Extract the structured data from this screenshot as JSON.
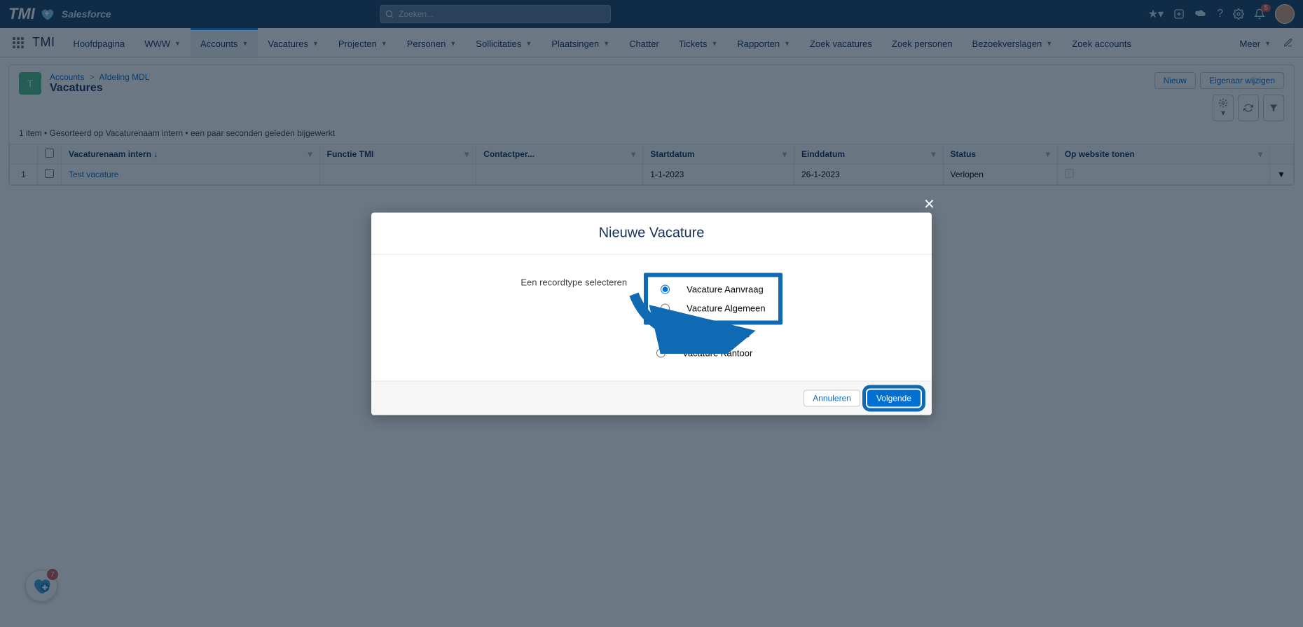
{
  "brand": {
    "main": "TMI",
    "sub": "Salesforce"
  },
  "search": {
    "placeholder": "Zoeken..."
  },
  "header_actions": {
    "notification_count": "5"
  },
  "app": {
    "name": "TMI"
  },
  "nav": [
    {
      "label": "Hoofdpagina",
      "dd": false
    },
    {
      "label": "WWW",
      "dd": true
    },
    {
      "label": "Accounts",
      "dd": true,
      "active": true
    },
    {
      "label": "Vacatures",
      "dd": true
    },
    {
      "label": "Projecten",
      "dd": true
    },
    {
      "label": "Personen",
      "dd": true
    },
    {
      "label": "Sollicitaties",
      "dd": true
    },
    {
      "label": "Plaatsingen",
      "dd": true
    },
    {
      "label": "Chatter",
      "dd": false
    },
    {
      "label": "Tickets",
      "dd": true
    },
    {
      "label": "Rapporten",
      "dd": true
    },
    {
      "label": "Zoek vacatures",
      "dd": false
    },
    {
      "label": "Zoek personen",
      "dd": false
    },
    {
      "label": "Bezoekverslagen",
      "dd": true
    },
    {
      "label": "Zoek accounts",
      "dd": false
    }
  ],
  "nav_more_label": "Meer",
  "breadcrumb": {
    "root": "Accounts",
    "leaf": "Afdeling MDL"
  },
  "page_title": "Vacatures",
  "page_actions": {
    "new": "Nieuw",
    "change_owner": "Eigenaar wijzigen"
  },
  "list_meta": "1 item • Gesorteerd op Vacaturenaam intern • een paar seconden geleden bijgewerkt",
  "columns": {
    "name": "Vacaturenaam intern",
    "function": "Functie TMI",
    "contact": "Contactper...",
    "start": "Startdatum",
    "end": "Einddatum",
    "status": "Status",
    "website": "Op website tonen"
  },
  "rows": [
    {
      "num": "1",
      "name": "Test vacature",
      "function": "",
      "contact": "",
      "start": "1-1-2023",
      "end": "26-1-2023",
      "status": "Verlopen",
      "website": false
    }
  ],
  "assist_badge": "7",
  "modal": {
    "title": "Nieuwe Vacature",
    "select_label": "Een recordtype selecteren",
    "options": [
      {
        "label": "Vacature Aanvraag",
        "checked": true,
        "hl": true
      },
      {
        "label": "Vacature Algemeen",
        "checked": false,
        "hl": true
      },
      {
        "label": "Vacature Cursus",
        "checked": false,
        "hl": false
      },
      {
        "label": "Vacature Kantoor",
        "checked": false,
        "hl": false
      }
    ],
    "cancel": "Annuleren",
    "next": "Volgende"
  }
}
